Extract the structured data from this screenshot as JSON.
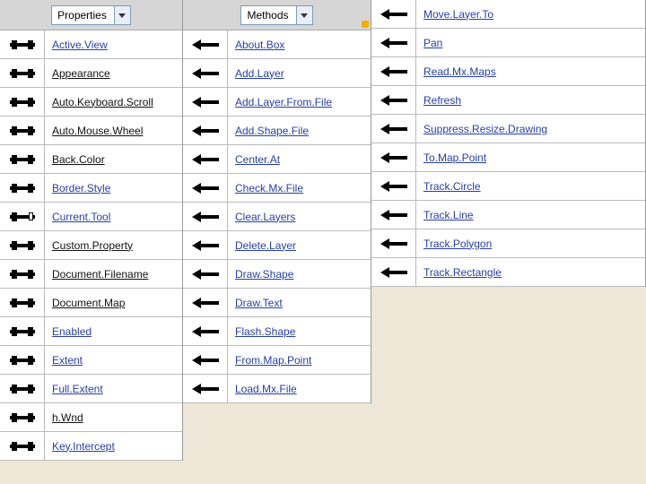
{
  "columns": [
    {
      "header": "Properties",
      "hasCombo": true,
      "items": [
        {
          "label": "Active.View",
          "icon": "prop",
          "link": true
        },
        {
          "label": "Appearance",
          "icon": "prop",
          "link": false
        },
        {
          "label": "Auto.Keyboard.Scroll",
          "icon": "prop",
          "link": false
        },
        {
          "label": "Auto.Mouse.Wheel",
          "icon": "prop",
          "link": false
        },
        {
          "label": "Back.Color",
          "icon": "prop",
          "link": false
        },
        {
          "label": "Border.Style",
          "icon": "prop",
          "link": true
        },
        {
          "label": "Current.Tool",
          "icon": "prop-hollow",
          "link": true
        },
        {
          "label": "Custom.Property",
          "icon": "prop",
          "link": false
        },
        {
          "label": "Document.Filename",
          "icon": "prop",
          "link": false
        },
        {
          "label": "Document.Map",
          "icon": "prop",
          "link": false
        },
        {
          "label": "Enabled",
          "icon": "prop",
          "link": true
        },
        {
          "label": "Extent",
          "icon": "prop",
          "link": true
        },
        {
          "label": "Full.Extent",
          "icon": "prop",
          "link": true
        },
        {
          "label": "h.Wnd",
          "icon": "prop",
          "link": false
        },
        {
          "label": "Key.Intercept",
          "icon": "prop",
          "link": true
        }
      ]
    },
    {
      "header": "Methods",
      "hasCombo": true,
      "dot": true,
      "items": [
        {
          "label": "About.Box",
          "icon": "arrow",
          "link": true
        },
        {
          "label": "Add.Layer",
          "icon": "arrow",
          "link": true
        },
        {
          "label": "Add.Layer.From.File",
          "icon": "arrow",
          "link": true
        },
        {
          "label": "Add.Shape.File",
          "icon": "arrow",
          "link": true
        },
        {
          "label": "Center.At",
          "icon": "arrow",
          "link": true
        },
        {
          "label": "Check.Mx.File",
          "icon": "arrow",
          "link": true
        },
        {
          "label": "Clear.Layers",
          "icon": "arrow",
          "link": true
        },
        {
          "label": "Delete.Layer",
          "icon": "arrow",
          "link": true
        },
        {
          "label": "Draw.Shape",
          "icon": "arrow",
          "link": true
        },
        {
          "label": "Draw.Text",
          "icon": "arrow",
          "link": true
        },
        {
          "label": "Flash.Shape",
          "icon": "arrow",
          "link": true
        },
        {
          "label": "From.Map.Point",
          "icon": "arrow",
          "link": true
        },
        {
          "label": "Load.Mx.File",
          "icon": "arrow",
          "link": true
        }
      ]
    },
    {
      "header": "",
      "hasCombo": false,
      "items": [
        {
          "label": "Move.Layer.To",
          "icon": "arrow",
          "link": true
        },
        {
          "label": "Pan",
          "icon": "arrow",
          "link": true
        },
        {
          "label": "Read.Mx.Maps",
          "icon": "arrow",
          "link": true
        },
        {
          "label": "Refresh",
          "icon": "arrow",
          "link": true
        },
        {
          "label": "Suppress.Resize.Drawing",
          "icon": "arrow",
          "link": true
        },
        {
          "label": "To.Map.Point",
          "icon": "arrow",
          "link": true
        },
        {
          "label": "Track.Circle",
          "icon": "arrow",
          "link": true
        },
        {
          "label": "Track.Line",
          "icon": "arrow",
          "link": true
        },
        {
          "label": "Track.Polygon",
          "icon": "arrow",
          "link": true
        },
        {
          "label": "Track.Rectangle",
          "icon": "arrow",
          "link": true
        }
      ]
    }
  ]
}
